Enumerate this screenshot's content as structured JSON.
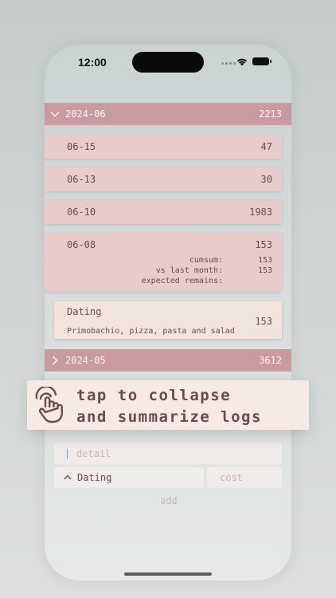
{
  "status_bar": {
    "time": "12:00"
  },
  "months": [
    {
      "label": "2024-06",
      "total": "2213",
      "expanded": true
    },
    {
      "label": "2024-05",
      "total": "3612",
      "expanded": false
    }
  ],
  "days": [
    {
      "date": "06-15",
      "cost": "47"
    },
    {
      "date": "06-13",
      "cost": "30"
    },
    {
      "date": "06-10",
      "cost": "1983"
    },
    {
      "date": "06-08",
      "cost": "153",
      "stats": {
        "cumsum_label": "cumsum:",
        "cumsum_value": "153",
        "vs_label": "vs last month:",
        "vs_value": "153",
        "remains_label": "expected remains:",
        "remains_value": ""
      }
    }
  ],
  "log": {
    "title": "Dating",
    "detail": "Primobachio, pizza, pasta and salad",
    "cost": "153"
  },
  "tooltip": {
    "line1": "tap to collapse",
    "line2": "and summarize logs",
    "icon": "hand-tap-icon"
  },
  "form": {
    "detail_placeholder": "detail",
    "category": "Dating",
    "cost_placeholder": "cost",
    "add_label": "add"
  },
  "colors": {
    "accent": "#c99ba1",
    "card": "#e8cccb",
    "log_card": "#f0e4dc",
    "text": "#6b4a4e"
  }
}
